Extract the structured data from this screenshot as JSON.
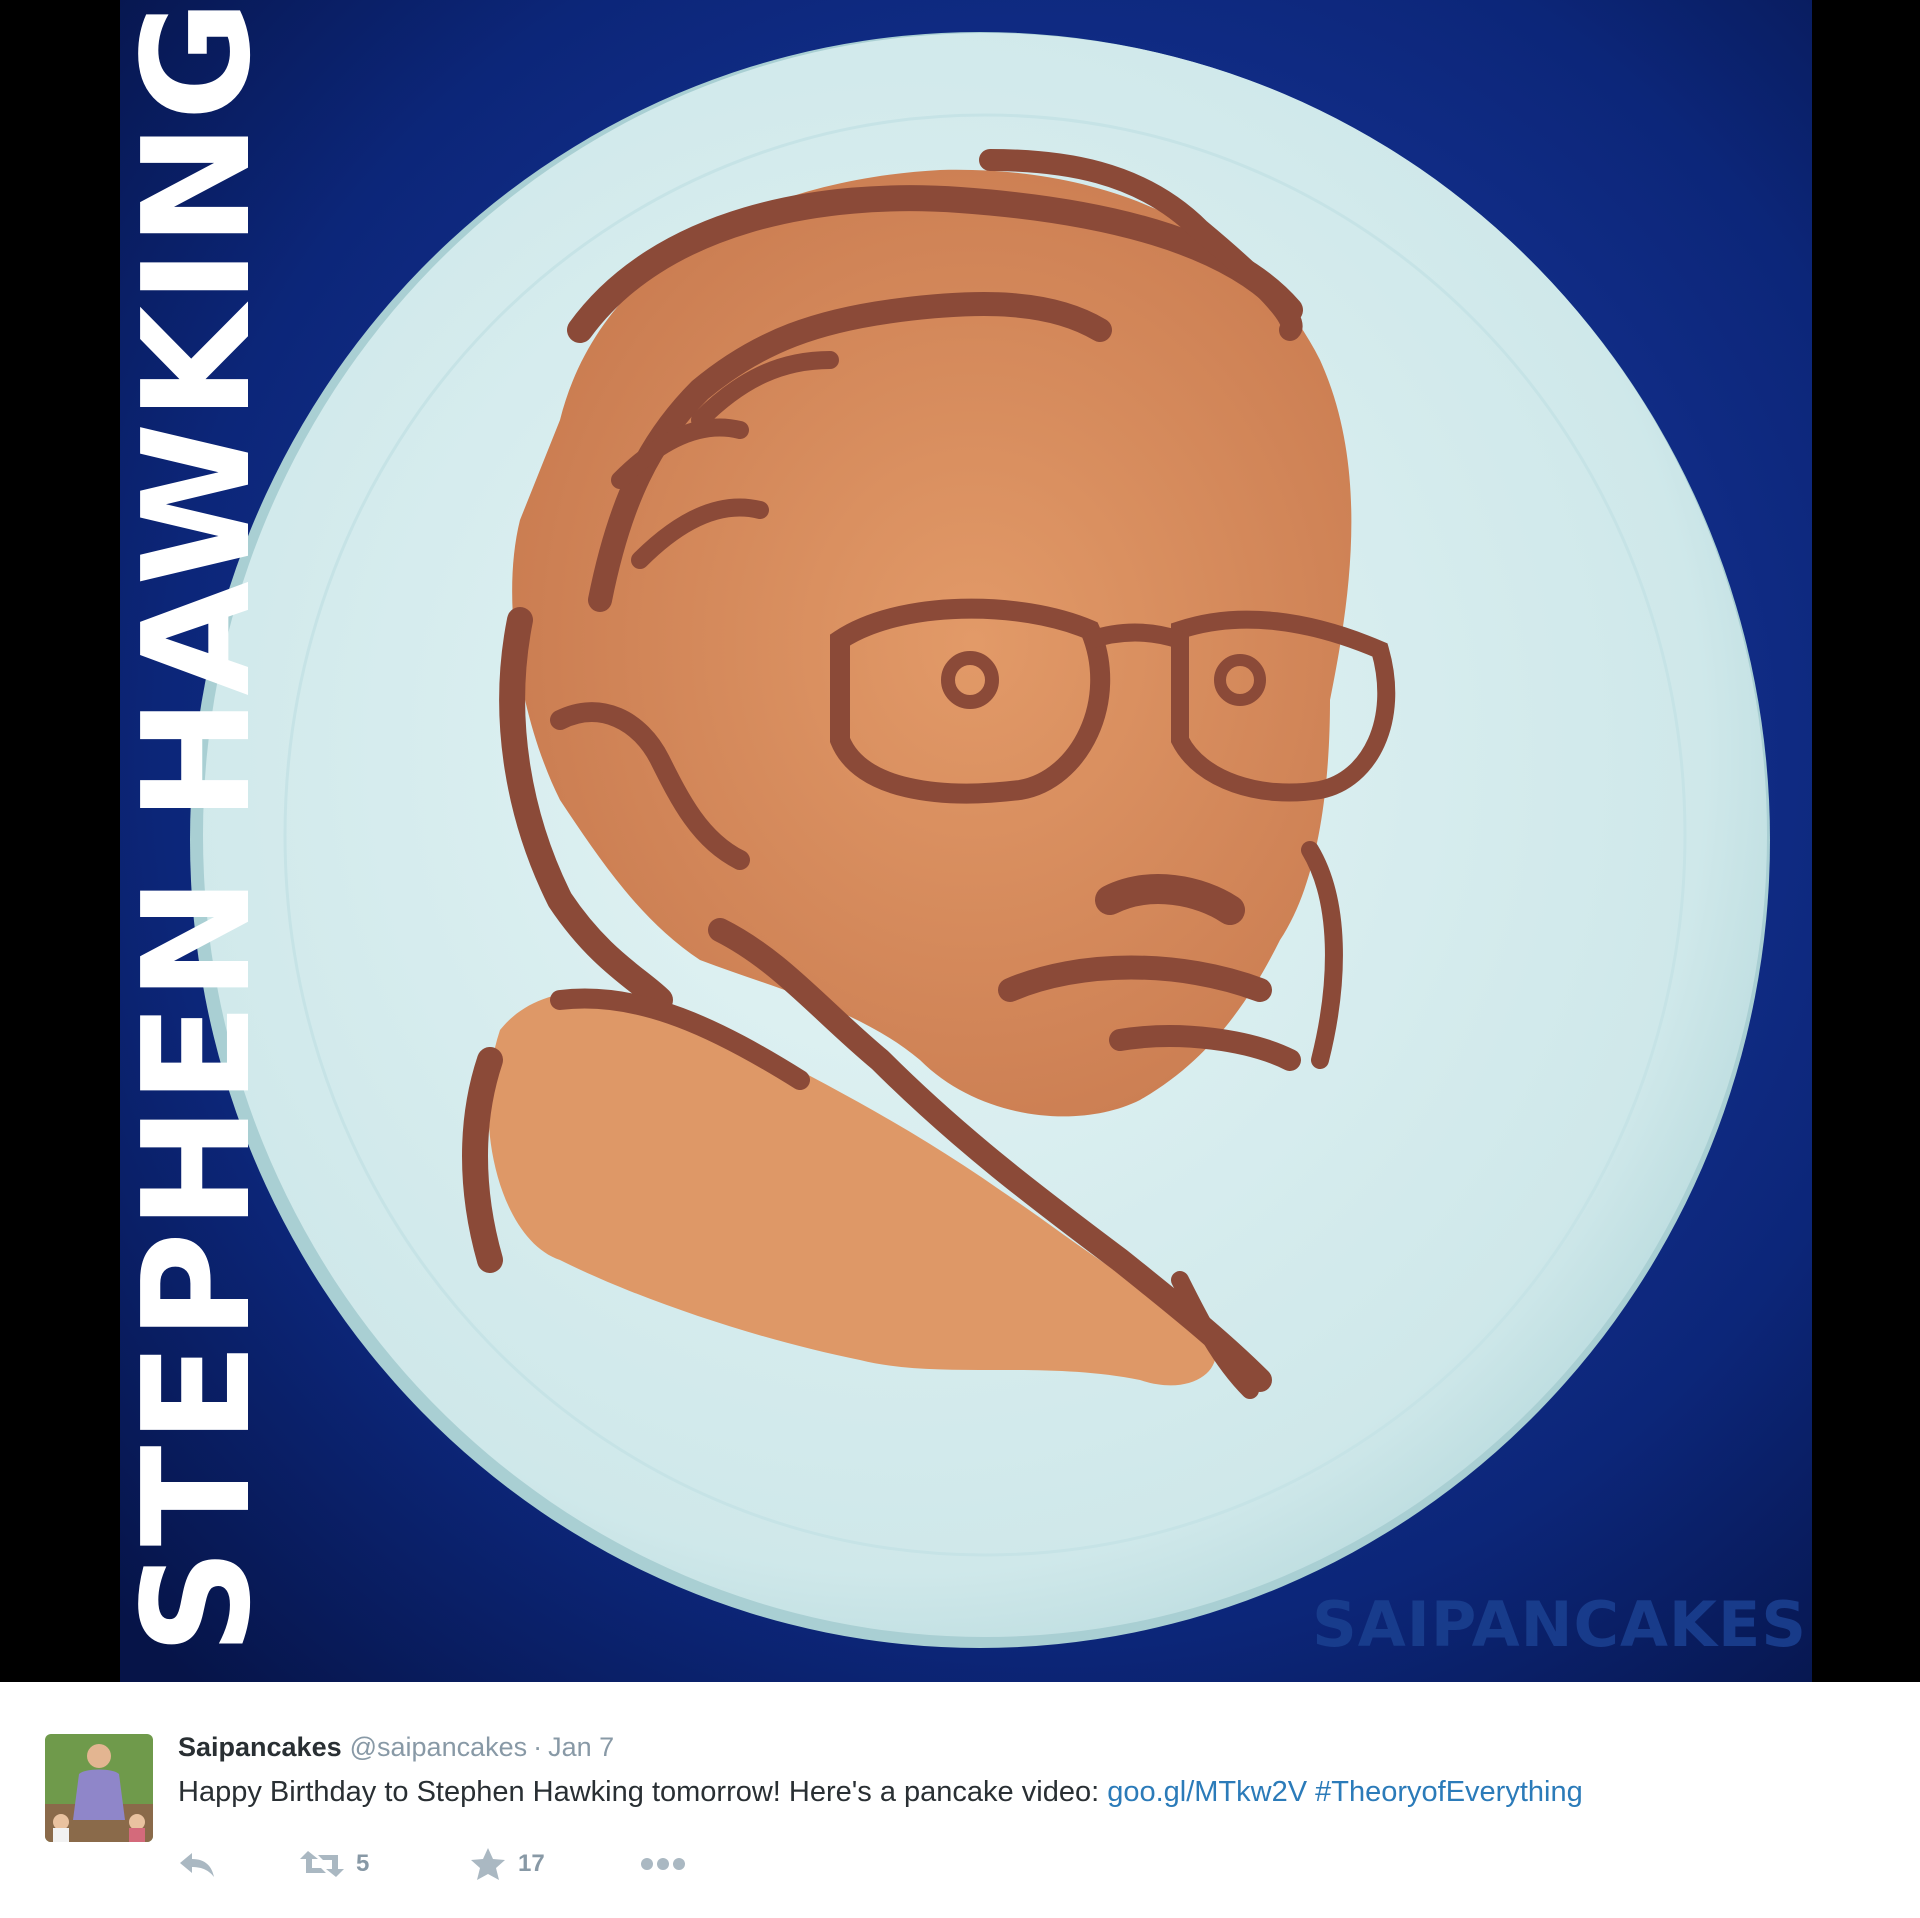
{
  "photo": {
    "vertical_title": "STEPHEN HAWKING",
    "watermark": "SAIPANCAKES"
  },
  "tweet": {
    "display_name": "Saipancakes",
    "handle": "@saipancakes",
    "separator": "·",
    "timestamp": "Jan 7",
    "text": "Happy Birthday to Stephen Hawking tomorrow!  Here's a pancake video: ",
    "link": "goo.gl/MTkw2V",
    "hashtag": "#TheoryofEverything",
    "actions": {
      "reply_icon": "reply-icon",
      "retweet_icon": "retweet-icon",
      "retweet_count": "5",
      "favorite_icon": "star-icon",
      "favorite_count": "17",
      "more_icon": "more-dots-icon"
    }
  },
  "colors": {
    "background_blue": "#0b1f6e",
    "plate": "#d4ecee",
    "pancake_light": "#d9905e",
    "pancake_dark": "#8b4a38",
    "link": "#2b7bb9",
    "muted": "#8899a6"
  }
}
